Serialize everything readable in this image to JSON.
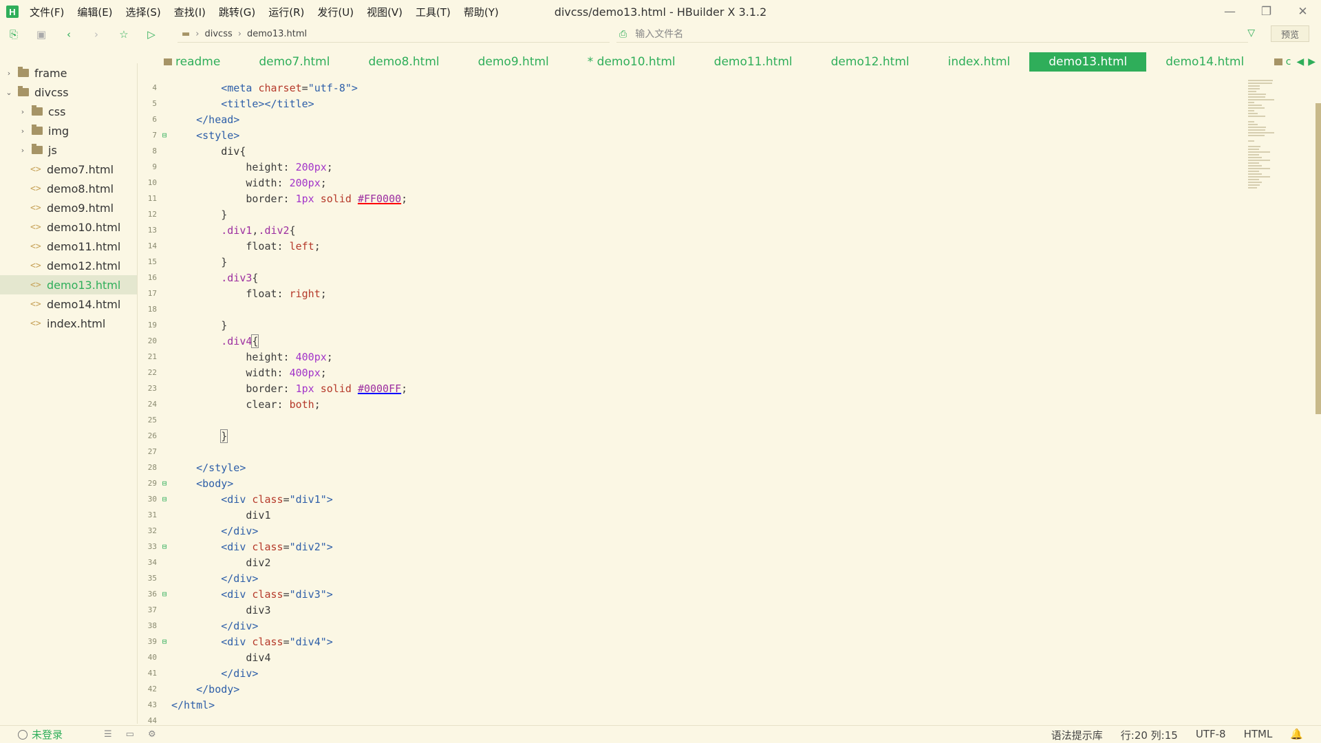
{
  "app": {
    "logo_letter": "H",
    "window_title": "divcss/demo13.html - HBuilder X 3.1.2"
  },
  "menu": [
    "文件(F)",
    "编辑(E)",
    "选择(S)",
    "查找(I)",
    "跳转(G)",
    "运行(R)",
    "发行(U)",
    "视图(V)",
    "工具(T)",
    "帮助(Y)"
  ],
  "toolbar": {
    "breadcrumb": [
      "divcss",
      "demo13.html"
    ],
    "file_search_placeholder": "输入文件名",
    "preview_label": "预览"
  },
  "sidebar": {
    "items": [
      {
        "type": "folder",
        "label": "frame",
        "expanded": false,
        "level": 0
      },
      {
        "type": "folder",
        "label": "divcss",
        "expanded": true,
        "level": 0
      },
      {
        "type": "folder",
        "label": "css",
        "expanded": false,
        "level": 1
      },
      {
        "type": "folder",
        "label": "img",
        "expanded": false,
        "level": 1
      },
      {
        "type": "folder",
        "label": "js",
        "expanded": false,
        "level": 1
      },
      {
        "type": "file",
        "label": "demo7.html"
      },
      {
        "type": "file",
        "label": "demo8.html"
      },
      {
        "type": "file",
        "label": "demo9.html"
      },
      {
        "type": "file",
        "label": "demo10.html"
      },
      {
        "type": "file",
        "label": "demo11.html"
      },
      {
        "type": "file",
        "label": "demo12.html"
      },
      {
        "type": "file",
        "label": "demo13.html",
        "active": true
      },
      {
        "type": "file",
        "label": "demo14.html"
      },
      {
        "type": "file",
        "label": "index.html"
      }
    ]
  },
  "tabs": [
    {
      "label": "readme",
      "folder": true
    },
    {
      "label": "demo7.html"
    },
    {
      "label": "demo8.html"
    },
    {
      "label": "demo9.html"
    },
    {
      "label": "* demo10.html"
    },
    {
      "label": "demo11.html"
    },
    {
      "label": "demo12.html"
    },
    {
      "label": "index.html"
    },
    {
      "label": "demo13.html",
      "active": true
    },
    {
      "label": "demo14.html"
    }
  ],
  "tabs_overflow": "c",
  "editor": {
    "lines": [
      {
        "n": "4",
        "fold": "",
        "html": "        <span class='t-tag'>&lt;meta</span> <span class='t-attr'>charset</span>=<span class='t-str'>\"utf-8\"</span><span class='t-tag'>&gt;</span>"
      },
      {
        "n": "5",
        "fold": "",
        "html": "        <span class='t-tag'>&lt;title&gt;&lt;/title&gt;</span>"
      },
      {
        "n": "6",
        "fold": "",
        "html": "    <span class='t-tag'>&lt;/head&gt;</span>"
      },
      {
        "n": "7",
        "fold": "⊟",
        "html": "    <span class='t-tag'>&lt;style&gt;</span>"
      },
      {
        "n": "8",
        "fold": "",
        "html": "        <span class='t-prop'>div{</span>"
      },
      {
        "n": "9",
        "fold": "",
        "html": "            height: <span class='t-num'>200px</span>;"
      },
      {
        "n": "10",
        "fold": "",
        "html": "            width: <span class='t-num'>200px</span>;"
      },
      {
        "n": "11",
        "fold": "",
        "html": "            border: <span class='t-num'>1px</span> <span class='t-kw'>solid</span> <span class='t-sel ul-red'>#FF0000</span>;"
      },
      {
        "n": "12",
        "fold": "",
        "html": "        }"
      },
      {
        "n": "13",
        "fold": "",
        "html": "        <span class='t-sel'>.div1</span>,<span class='t-sel'>.div2</span>{"
      },
      {
        "n": "14",
        "fold": "",
        "html": "            float: <span class='t-kw'>left</span>;"
      },
      {
        "n": "15",
        "fold": "",
        "html": "        }"
      },
      {
        "n": "16",
        "fold": "",
        "html": "        <span class='t-sel'>.div3</span>{"
      },
      {
        "n": "17",
        "fold": "",
        "html": "            float: <span class='t-kw'>right</span>;"
      },
      {
        "n": "18",
        "fold": "",
        "html": ""
      },
      {
        "n": "19",
        "fold": "",
        "html": "        }"
      },
      {
        "n": "20",
        "fold": "",
        "html": "        <span class='t-sel'>.div4</span><span class='caret-box'>{</span>"
      },
      {
        "n": "21",
        "fold": "",
        "html": "            height: <span class='t-num'>400px</span>;"
      },
      {
        "n": "22",
        "fold": "",
        "html": "            width: <span class='t-num'>400px</span>;"
      },
      {
        "n": "23",
        "fold": "",
        "html": "            border: <span class='t-num'>1px</span> <span class='t-kw'>solid</span> <span class='t-sel ul-blue'>#0000FF</span>;"
      },
      {
        "n": "24",
        "fold": "",
        "html": "            clear: <span class='t-kw'>both</span>;"
      },
      {
        "n": "25",
        "fold": "",
        "html": ""
      },
      {
        "n": "26",
        "fold": "",
        "html": "        <span class='caret-box'>}</span>"
      },
      {
        "n": "27",
        "fold": "",
        "html": ""
      },
      {
        "n": "28",
        "fold": "",
        "html": "    <span class='t-tag'>&lt;/style&gt;</span>"
      },
      {
        "n": "29",
        "fold": "⊟",
        "html": "    <span class='t-tag'>&lt;body&gt;</span>"
      },
      {
        "n": "30",
        "fold": "⊟",
        "html": "        <span class='t-tag'>&lt;div</span> <span class='t-attr'>class</span>=<span class='t-str'>\"div1\"</span><span class='t-tag'>&gt;</span>"
      },
      {
        "n": "31",
        "fold": "",
        "html": "            div1"
      },
      {
        "n": "32",
        "fold": "",
        "html": "        <span class='t-tag'>&lt;/div&gt;</span>"
      },
      {
        "n": "33",
        "fold": "⊟",
        "html": "        <span class='t-tag'>&lt;div</span> <span class='t-attr'>class</span>=<span class='t-str'>\"div2\"</span><span class='t-tag'>&gt;</span>"
      },
      {
        "n": "34",
        "fold": "",
        "html": "            div2"
      },
      {
        "n": "35",
        "fold": "",
        "html": "        <span class='t-tag'>&lt;/div&gt;</span>"
      },
      {
        "n": "36",
        "fold": "⊟",
        "html": "        <span class='t-tag'>&lt;div</span> <span class='t-attr'>class</span>=<span class='t-str'>\"div3\"</span><span class='t-tag'>&gt;</span>"
      },
      {
        "n": "37",
        "fold": "",
        "html": "            div3"
      },
      {
        "n": "38",
        "fold": "",
        "html": "        <span class='t-tag'>&lt;/div&gt;</span>"
      },
      {
        "n": "39",
        "fold": "⊟",
        "html": "        <span class='t-tag'>&lt;div</span> <span class='t-attr'>class</span>=<span class='t-str'>\"div4\"</span><span class='t-tag'>&gt;</span>"
      },
      {
        "n": "40",
        "fold": "",
        "html": "            div4"
      },
      {
        "n": "41",
        "fold": "",
        "html": "        <span class='t-tag'>&lt;/div&gt;</span>"
      },
      {
        "n": "42",
        "fold": "",
        "html": "    <span class='t-tag'>&lt;/body&gt;</span>"
      },
      {
        "n": "43",
        "fold": "",
        "html": "<span class='t-tag'>&lt;/html&gt;</span>"
      },
      {
        "n": "44",
        "fold": "",
        "html": ""
      }
    ]
  },
  "statusbar": {
    "login_label": "未登录",
    "syntax_lib": "语法提示库",
    "line_col": "行:20  列:15",
    "encoding": "UTF-8",
    "language": "HTML"
  },
  "icons": {
    "accent": "#2fae5a",
    "folder": "#a69466"
  }
}
